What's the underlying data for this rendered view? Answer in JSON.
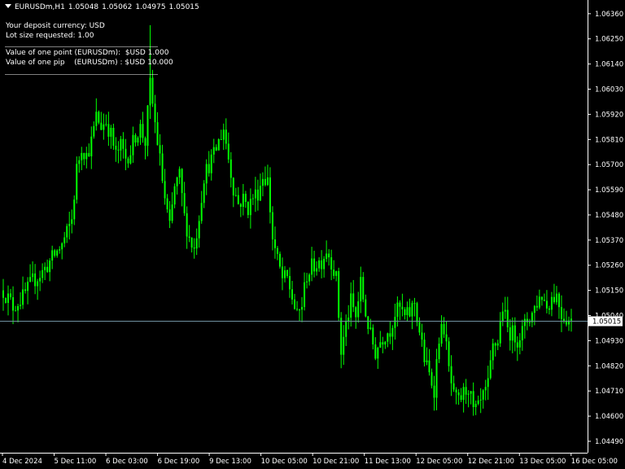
{
  "header": {
    "symbol": "EURUSDm,H1",
    "open": "1.05048",
    "high": "1.05062",
    "low": "1.04975",
    "close": "1.05015"
  },
  "info_panel": {
    "deposit_currency": "Your deposit currency: USD",
    "lot_size": "Lot size requested: 1.00",
    "point_value": "Value of one point (EURUSDm):  $USD 1.000",
    "pip_value": "Value of one pip    (EURUSDm) : $USD 10.000"
  },
  "colors": {
    "background": "#000000",
    "candle": "#00ff00",
    "axis": "#ffffff",
    "price_line": "#6f8fa0",
    "price_label_bg": "#ffffff",
    "price_label_text": "#000000"
  },
  "chart_data": {
    "type": "candlestick",
    "title": "",
    "ylim": [
      1.0444,
      1.0642
    ],
    "y_ticks": [
      "1.06360",
      "1.06250",
      "1.06140",
      "1.06030",
      "1.05920",
      "1.05810",
      "1.05700",
      "1.05590",
      "1.05480",
      "1.05370",
      "1.05260",
      "1.05150",
      "1.05040",
      "1.04930",
      "1.04820",
      "1.04710",
      "1.04600",
      "1.04490"
    ],
    "x_ticks": [
      "4 Dec 2024",
      "5 Dec 11:00",
      "6 Dec 03:00",
      "6 Dec 19:00",
      "9 Dec 13:00",
      "10 Dec 05:00",
      "10 Dec 21:00",
      "11 Dec 13:00",
      "12 Dec 05:00",
      "12 Dec 21:00",
      "13 Dec 05:00",
      "16 Dec 05:00"
    ],
    "current_price": 1.05015,
    "current_price_label": "1.05015",
    "close_path": [
      [
        0,
        1.0515
      ],
      [
        4,
        1.0508
      ],
      [
        8,
        1.0512
      ],
      [
        12,
        1.0519
      ],
      [
        16,
        1.0523
      ],
      [
        20,
        1.0529
      ],
      [
        24,
        1.0535
      ],
      [
        26,
        1.054
      ],
      [
        28,
        1.0546
      ],
      [
        30,
        1.0568
      ],
      [
        32,
        1.0578
      ],
      [
        34,
        1.0574
      ],
      [
        36,
        1.058
      ],
      [
        38,
        1.0591
      ],
      [
        40,
        1.0587
      ],
      [
        42,
        1.0589
      ],
      [
        44,
        1.0583
      ],
      [
        46,
        1.0574
      ],
      [
        48,
        1.0578
      ],
      [
        50,
        1.0573
      ],
      [
        52,
        1.0576
      ],
      [
        54,
        1.0583
      ],
      [
        56,
        1.0586
      ],
      [
        58,
        1.058
      ],
      [
        60,
        1.0605
      ],
      [
        62,
        1.0588
      ],
      [
        64,
        1.0572
      ],
      [
        66,
        1.0555
      ],
      [
        68,
        1.0542
      ],
      [
        70,
        1.056
      ],
      [
        72,
        1.0565
      ],
      [
        74,
        1.0547
      ],
      [
        76,
        1.0538
      ],
      [
        78,
        1.0533
      ],
      [
        80,
        1.0548
      ],
      [
        82,
        1.0565
      ],
      [
        84,
        1.057
      ],
      [
        86,
        1.0574
      ],
      [
        88,
        1.058
      ],
      [
        90,
        1.0586
      ],
      [
        92,
        1.0573
      ],
      [
        94,
        1.056
      ],
      [
        96,
        1.0553
      ],
      [
        98,
        1.0555
      ],
      [
        100,
        1.0551
      ],
      [
        102,
        1.0556
      ],
      [
        104,
        1.0558
      ],
      [
        106,
        1.0565
      ],
      [
        108,
        1.0563
      ],
      [
        110,
        1.0538
      ],
      [
        112,
        1.0528
      ],
      [
        114,
        1.052
      ],
      [
        116,
        1.052
      ],
      [
        118,
        1.0512
      ],
      [
        120,
        1.0503
      ],
      [
        122,
        1.0509
      ],
      [
        124,
        1.0522
      ],
      [
        126,
        1.0525
      ],
      [
        128,
        1.0527
      ],
      [
        130,
        1.0528
      ],
      [
        132,
        1.0533
      ],
      [
        134,
        1.0528
      ],
      [
        136,
        1.052
      ],
      [
        138,
        1.0488
      ],
      [
        140,
        1.05
      ],
      [
        142,
        1.051
      ],
      [
        144,
        1.0503
      ],
      [
        146,
        1.0518
      ],
      [
        148,
        1.0505
      ],
      [
        150,
        1.0495
      ],
      [
        152,
        1.0488
      ],
      [
        154,
        1.0493
      ],
      [
        156,
        1.0496
      ],
      [
        158,
        1.0498
      ],
      [
        160,
        1.0505
      ],
      [
        162,
        1.0507
      ],
      [
        164,
        1.0503
      ],
      [
        166,
        1.0505
      ],
      [
        168,
        1.051
      ],
      [
        170,
        1.0497
      ],
      [
        172,
        1.0485
      ],
      [
        174,
        1.0478
      ],
      [
        176,
        1.0472
      ],
      [
        178,
        1.0495
      ],
      [
        180,
        1.0499
      ],
      [
        182,
        1.048
      ],
      [
        184,
        1.0468
      ],
      [
        186,
        1.0466
      ],
      [
        188,
        1.047
      ],
      [
        190,
        1.0473
      ],
      [
        192,
        1.0462
      ],
      [
        194,
        1.0463
      ],
      [
        196,
        1.0468
      ],
      [
        198,
        1.0473
      ],
      [
        200,
        1.049
      ],
      [
        202,
        1.0493
      ],
      [
        204,
        1.0508
      ],
      [
        206,
        1.0498
      ],
      [
        208,
        1.0496
      ],
      [
        210,
        1.0494
      ],
      [
        212,
        1.0497
      ],
      [
        214,
        1.0502
      ],
      [
        216,
        1.0505
      ],
      [
        218,
        1.051
      ],
      [
        220,
        1.0513
      ],
      [
        222,
        1.0508
      ],
      [
        224,
        1.0512
      ],
      [
        226,
        1.0513
      ],
      [
        228,
        1.0505
      ],
      [
        230,
        1.0503
      ],
      [
        232,
        1.0501
      ]
    ],
    "spikes": {
      "60": [
        1.059,
        1.0631
      ]
    }
  }
}
